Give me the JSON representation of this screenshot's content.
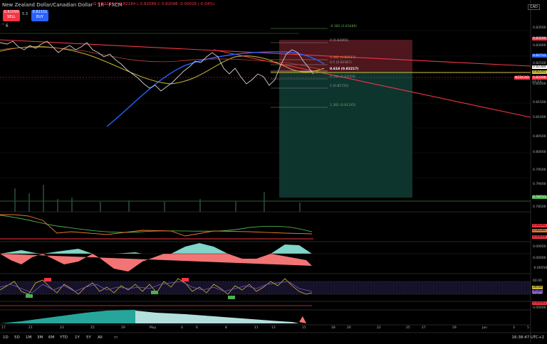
{
  "header": {
    "symbol_title": "New Zealand Dollar/Canadian Dollar · 1h · FXCM",
    "ohlc": "O 0.82124  H 0.82184  L 0.82089  C 0.82098  -0.00026 (-0.04%)",
    "sell_price": "0.82099",
    "sell_label": "SELL",
    "buy_price": "0.82151",
    "buy_label": "BUY",
    "spread": "5.3",
    "indicators_count": "6",
    "currency": "CAD"
  },
  "fib_labels": [
    "-0.382 (0.83489)",
    "0 (0.83005)",
    "0.382 (0.82517)",
    "0.5 (0.82367)",
    "0.618 (0.82217)",
    "0.786 (0.82004)",
    "1 (0.81731)",
    "1.382 (0.81245)"
  ],
  "price_axis": [
    "0.83500",
    "0.83190",
    "0.83000",
    "0.82712",
    "0.82500",
    "0.82384",
    "0.82245",
    "0.82098",
    "0.82000",
    "0.81500",
    "0.81000",
    "0.80500",
    "0.80000",
    "0.79500",
    "0.79000",
    "0.78711",
    "0.78500"
  ],
  "symbol_badge": "NZDCAD",
  "countdown": "21:13",
  "pane_values": {
    "p1": [
      "0.00292",
      "0.00285",
      "0.00000"
    ],
    "p2": [
      "0.00050",
      "0.00000",
      "-0.00050"
    ],
    "p3": [
      "60.00",
      "39.09",
      "35.45",
      "20.00"
    ],
    "p4": [
      "0.00141",
      "0.00000"
    ]
  },
  "time_axis": [
    "17",
    "21",
    "23",
    "25",
    "29",
    "May",
    "4",
    "6",
    "8",
    "11",
    "13",
    "15",
    "18",
    "20",
    "22",
    "25",
    "27",
    "29",
    "Jun",
    "3",
    "5"
  ],
  "timeframes": [
    "1D",
    "5D",
    "1M",
    "3M",
    "6M",
    "YTD",
    "1Y",
    "5Y",
    "All"
  ],
  "clock": "16:38:47 UTC+2",
  "colors": {
    "red": "#f23645",
    "blue": "#2962ff",
    "green": "#4caf50",
    "yellow": "#d4c43a",
    "teal": "#26a69a"
  }
}
